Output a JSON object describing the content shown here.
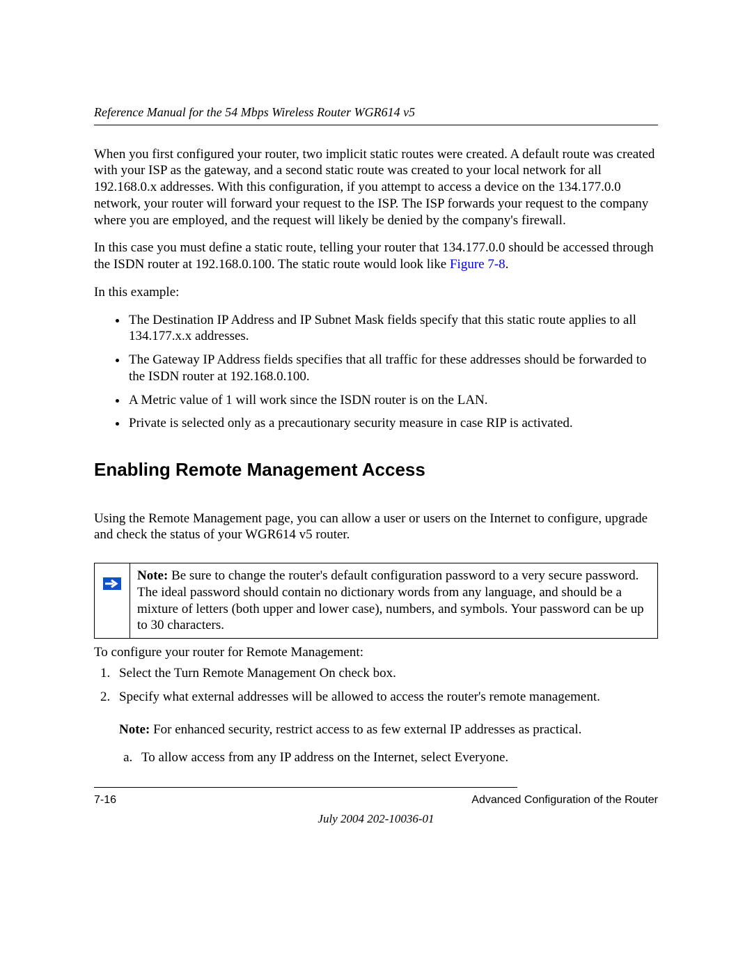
{
  "header": {
    "running_title": "Reference Manual for the 54 Mbps Wireless Router WGR614 v5"
  },
  "body": {
    "para1": "When you first configured your router, two implicit static routes were created. A default route was created with your ISP as the gateway, and a second static route was created to your local network for all 192.168.0.x addresses. With this configuration, if you attempt to access a device on the 134.177.0.0 network, your router will forward your request to the ISP. The ISP forwards your request to the company where you are employed, and the request will likely be denied by the company's firewall.",
    "para2_pre": "In this case you must define a static route, telling your router that 134.177.0.0 should be accessed through the ISDN router at 192.168.0.100. The static route would look like ",
    "para2_link": "Figure 7-8",
    "para2_post": ".",
    "para3": "In this example:",
    "bullets": [
      "The Destination IP Address and IP Subnet Mask fields specify that this static route applies to all 134.177.x.x addresses.",
      "The Gateway IP Address fields specifies that all traffic for these addresses should be forwarded to the ISDN router at 192.168.0.100.",
      "A Metric value of 1 will work since the ISDN router is on the LAN.",
      "Private is selected only as a precautionary security measure in case RIP is activated."
    ],
    "section_heading": "Enabling Remote Management Access",
    "para4": "Using the Remote Management page, you can allow a user or users on the Internet to configure, upgrade and check the status of your WGR614 v5 router.",
    "note_label": "Note:",
    "note_text": " Be sure to change the router's default configuration password to a very secure password. The ideal password should contain no dictionary words from any language, and should be a mixture of letters (both upper and lower case), numbers, and symbols. Your password can be up to 30 characters.",
    "para5": "To configure your router for Remote Management:",
    "step1": "Select the Turn Remote Management On check box.",
    "step2": "Specify what external addresses will be allowed to access the router's remote management.",
    "step2_note_label": "Note:",
    "step2_note_text": " For enhanced security, restrict access to as few external IP addresses as practical.",
    "step2a": "To allow access from any IP address on the Internet, select Everyone."
  },
  "footer": {
    "page_num": "7-16",
    "section": "Advanced Configuration of the Router",
    "date_doc": "July 2004 202-10036-01"
  }
}
